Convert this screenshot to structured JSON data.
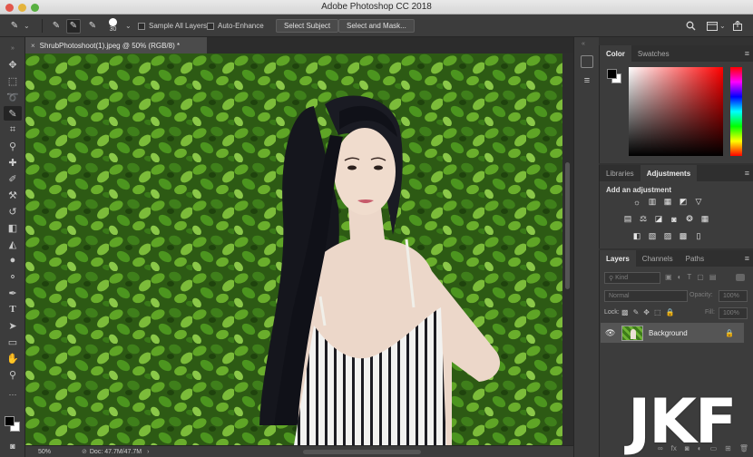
{
  "window": {
    "title": "Adobe Photoshop CC 2018"
  },
  "options_bar": {
    "brush_size": "30",
    "sample_all_layers_label": "Sample All Layers",
    "auto_enhance_label": "Auto-Enhance",
    "select_subject_label": "Select Subject",
    "select_and_mask_label": "Select and Mask..."
  },
  "document": {
    "tab_title": "ShrubPhotoshoot(1).jpeg @ 50% (RGB/8) *",
    "zoom": "50%",
    "doc_size": "Doc: 47.7M/47.7M"
  },
  "colors": {
    "foreground": "#000000",
    "background": "#ffffff",
    "panel_bg": "#3c3c3c",
    "accent_active": "#242424"
  },
  "color_panel": {
    "tabs": [
      "Color",
      "Swatches"
    ]
  },
  "adjustments_panel": {
    "tabs": [
      "Libraries",
      "Adjustments"
    ],
    "heading": "Add an adjustment"
  },
  "layers_panel": {
    "tabs": [
      "Layers",
      "Channels",
      "Paths"
    ],
    "filter_kind": "Kind",
    "blend_mode": "Normal",
    "opacity_label": "Opacity:",
    "opacity_value": "100%",
    "lock_label": "Lock:",
    "fill_label": "Fill:",
    "fill_value": "100%",
    "layers": [
      {
        "name": "Background"
      }
    ]
  },
  "watermark": {
    "text": "JKF"
  }
}
